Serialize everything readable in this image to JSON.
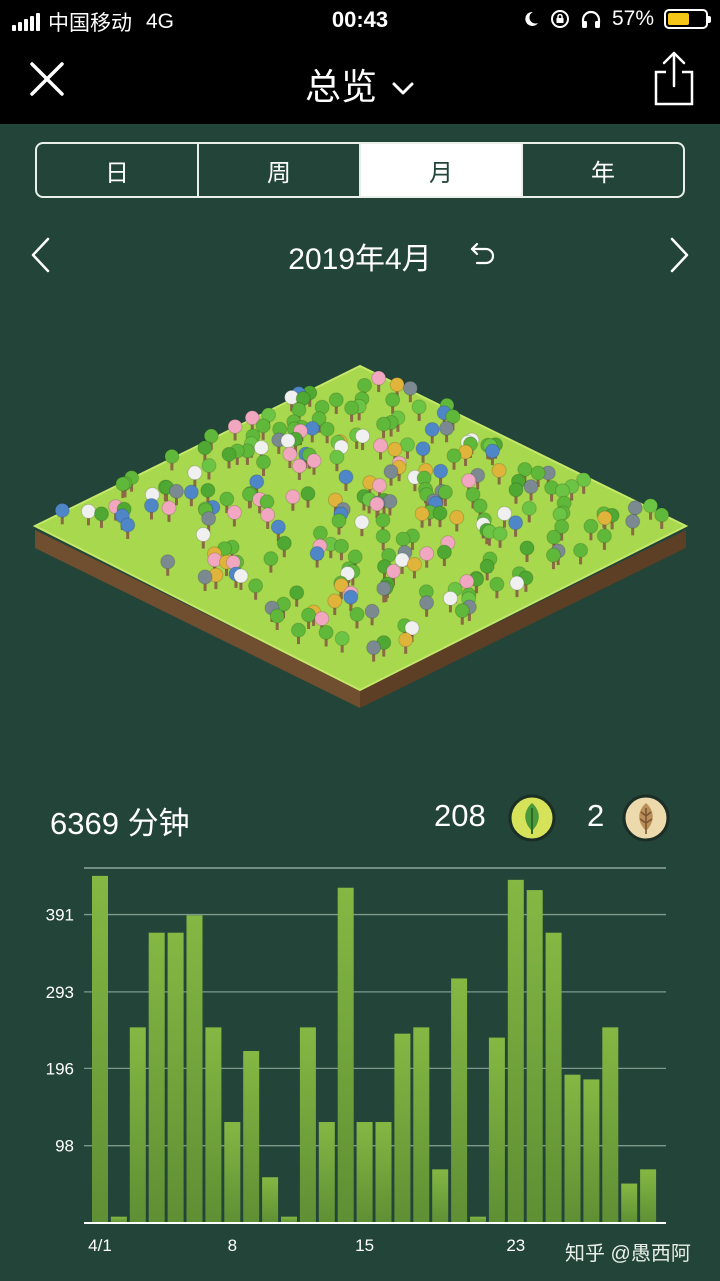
{
  "status_bar": {
    "carrier": "中国移动",
    "network": "4G",
    "time": "00:43",
    "battery": "57%",
    "battery_level": 0.57,
    "battery_color": "#f5c518"
  },
  "nav": {
    "title": "总览",
    "close_icon": "close-icon",
    "dropdown_icon": "chevron-down-icon",
    "share_icon": "share-icon"
  },
  "period_tabs": [
    {
      "label": "日",
      "active": false
    },
    {
      "label": "周",
      "active": false
    },
    {
      "label": "月",
      "active": true
    },
    {
      "label": "年",
      "active": false
    }
  ],
  "date_nav": {
    "label": "2019年4月",
    "prev_icon": "chevron-left-icon",
    "next_icon": "chevron-right-icon",
    "reset_icon": "undo-icon"
  },
  "stats": {
    "minutes": "6369 分钟",
    "healthy_trees": "208",
    "dead_trees": "2"
  },
  "colors": {
    "background": "#234438",
    "bar": "#7fb040",
    "grass": "#a8d84e",
    "soil": "#7a5634"
  },
  "chart_data": {
    "type": "bar",
    "categories": [
      "4/1",
      "",
      "",
      "",
      "",
      "",
      "",
      "8",
      "",
      "",
      "",
      "",
      "",
      "",
      "15",
      "",
      "",
      "",
      "",
      "",
      "",
      "",
      "23",
      "",
      "",
      "",
      "",
      "",
      "",
      ""
    ],
    "x_tick_labels": [
      "4/1",
      "8",
      "15",
      "23"
    ],
    "y_tick_labels": [
      "98",
      "196",
      "293",
      "391"
    ],
    "ylim": [
      0,
      450
    ],
    "values": [
      440,
      8,
      248,
      368,
      368,
      390,
      248,
      128,
      218,
      58,
      8,
      248,
      128,
      425,
      128,
      128,
      240,
      248,
      68,
      310,
      8,
      235,
      435,
      422,
      368,
      188,
      182,
      248,
      50,
      68
    ],
    "grid": true
  },
  "watermark": "知乎 @愚西阿"
}
